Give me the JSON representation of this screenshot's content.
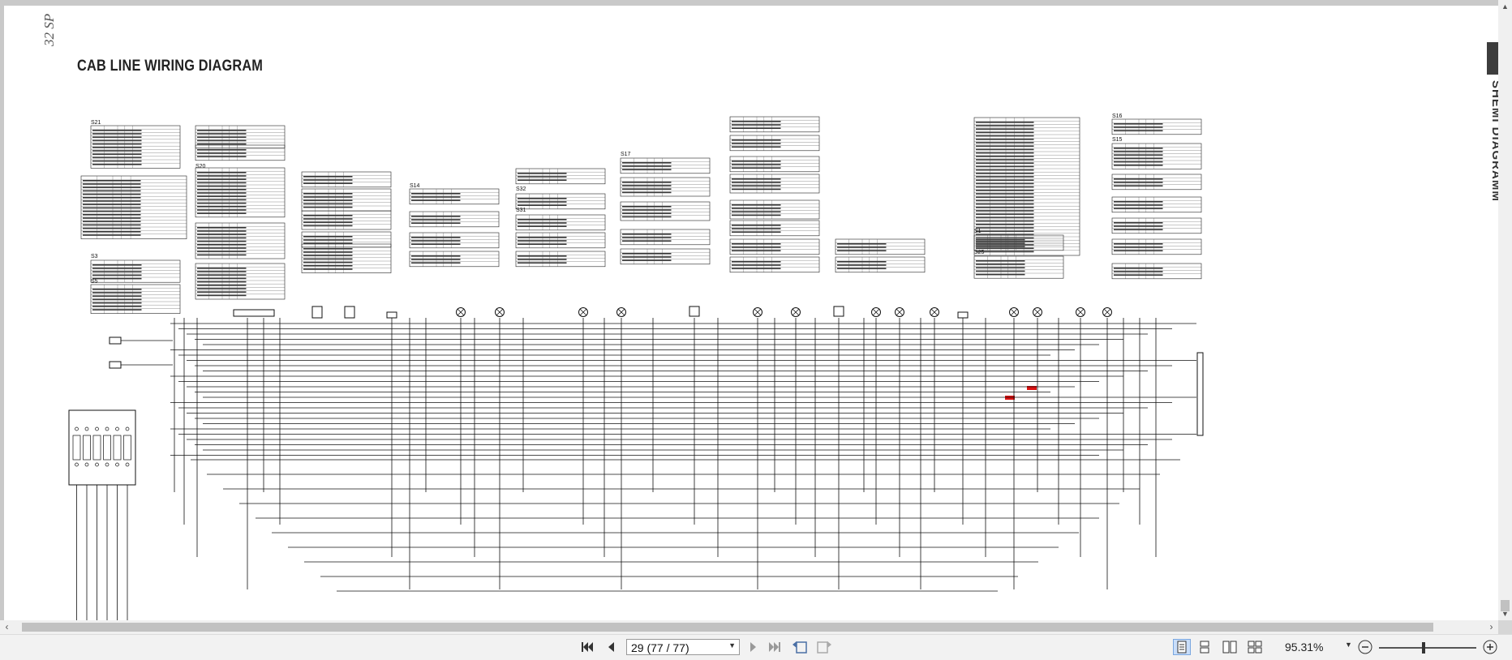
{
  "document": {
    "page_number_label": "32 SP",
    "title": "CAB LINE WIRING DIAGRAM",
    "side_tab_label": "SHEMI DIAGRAMM"
  },
  "tables": [
    {
      "label": "S21"
    },
    {
      "label": "S20"
    },
    {
      "label": "S3"
    },
    {
      "label": "S5"
    },
    {
      "label": "S14"
    },
    {
      "label": "S32"
    },
    {
      "label": "S31"
    },
    {
      "label": "S17"
    },
    {
      "label": "S1"
    },
    {
      "label": "S25"
    },
    {
      "label": "S16"
    },
    {
      "label": "S15"
    }
  ],
  "toolbar": {
    "page_value": "29 (77 / 77)",
    "zoom_value": "95.31%"
  },
  "icons": {
    "first": "first-page-icon",
    "prev": "previous-page-icon",
    "next": "next-page-icon",
    "last": "last-page-icon",
    "back": "previous-view-icon",
    "forward": "next-view-icon",
    "single": "single-page-view-icon",
    "continuous": "continuous-view-icon",
    "facing": "facing-view-icon",
    "continuous_facing": "continuous-facing-view-icon",
    "zoom_out": "zoom-out-icon",
    "zoom_in": "zoom-in-icon"
  }
}
